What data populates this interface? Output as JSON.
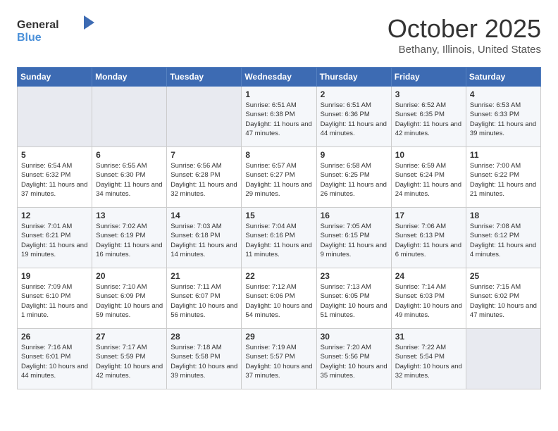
{
  "logo": {
    "general": "General",
    "blue": "Blue"
  },
  "header": {
    "title": "October 2025",
    "subtitle": "Bethany, Illinois, United States"
  },
  "weekdays": [
    "Sunday",
    "Monday",
    "Tuesday",
    "Wednesday",
    "Thursday",
    "Friday",
    "Saturday"
  ],
  "weeks": [
    [
      {
        "day": "",
        "sunrise": "",
        "sunset": "",
        "daylight": ""
      },
      {
        "day": "",
        "sunrise": "",
        "sunset": "",
        "daylight": ""
      },
      {
        "day": "",
        "sunrise": "",
        "sunset": "",
        "daylight": ""
      },
      {
        "day": "1",
        "sunrise": "Sunrise: 6:51 AM",
        "sunset": "Sunset: 6:38 PM",
        "daylight": "Daylight: 11 hours and 47 minutes."
      },
      {
        "day": "2",
        "sunrise": "Sunrise: 6:51 AM",
        "sunset": "Sunset: 6:36 PM",
        "daylight": "Daylight: 11 hours and 44 minutes."
      },
      {
        "day": "3",
        "sunrise": "Sunrise: 6:52 AM",
        "sunset": "Sunset: 6:35 PM",
        "daylight": "Daylight: 11 hours and 42 minutes."
      },
      {
        "day": "4",
        "sunrise": "Sunrise: 6:53 AM",
        "sunset": "Sunset: 6:33 PM",
        "daylight": "Daylight: 11 hours and 39 minutes."
      }
    ],
    [
      {
        "day": "5",
        "sunrise": "Sunrise: 6:54 AM",
        "sunset": "Sunset: 6:32 PM",
        "daylight": "Daylight: 11 hours and 37 minutes."
      },
      {
        "day": "6",
        "sunrise": "Sunrise: 6:55 AM",
        "sunset": "Sunset: 6:30 PM",
        "daylight": "Daylight: 11 hours and 34 minutes."
      },
      {
        "day": "7",
        "sunrise": "Sunrise: 6:56 AM",
        "sunset": "Sunset: 6:28 PM",
        "daylight": "Daylight: 11 hours and 32 minutes."
      },
      {
        "day": "8",
        "sunrise": "Sunrise: 6:57 AM",
        "sunset": "Sunset: 6:27 PM",
        "daylight": "Daylight: 11 hours and 29 minutes."
      },
      {
        "day": "9",
        "sunrise": "Sunrise: 6:58 AM",
        "sunset": "Sunset: 6:25 PM",
        "daylight": "Daylight: 11 hours and 26 minutes."
      },
      {
        "day": "10",
        "sunrise": "Sunrise: 6:59 AM",
        "sunset": "Sunset: 6:24 PM",
        "daylight": "Daylight: 11 hours and 24 minutes."
      },
      {
        "day": "11",
        "sunrise": "Sunrise: 7:00 AM",
        "sunset": "Sunset: 6:22 PM",
        "daylight": "Daylight: 11 hours and 21 minutes."
      }
    ],
    [
      {
        "day": "12",
        "sunrise": "Sunrise: 7:01 AM",
        "sunset": "Sunset: 6:21 PM",
        "daylight": "Daylight: 11 hours and 19 minutes."
      },
      {
        "day": "13",
        "sunrise": "Sunrise: 7:02 AM",
        "sunset": "Sunset: 6:19 PM",
        "daylight": "Daylight: 11 hours and 16 minutes."
      },
      {
        "day": "14",
        "sunrise": "Sunrise: 7:03 AM",
        "sunset": "Sunset: 6:18 PM",
        "daylight": "Daylight: 11 hours and 14 minutes."
      },
      {
        "day": "15",
        "sunrise": "Sunrise: 7:04 AM",
        "sunset": "Sunset: 6:16 PM",
        "daylight": "Daylight: 11 hours and 11 minutes."
      },
      {
        "day": "16",
        "sunrise": "Sunrise: 7:05 AM",
        "sunset": "Sunset: 6:15 PM",
        "daylight": "Daylight: 11 hours and 9 minutes."
      },
      {
        "day": "17",
        "sunrise": "Sunrise: 7:06 AM",
        "sunset": "Sunset: 6:13 PM",
        "daylight": "Daylight: 11 hours and 6 minutes."
      },
      {
        "day": "18",
        "sunrise": "Sunrise: 7:08 AM",
        "sunset": "Sunset: 6:12 PM",
        "daylight": "Daylight: 11 hours and 4 minutes."
      }
    ],
    [
      {
        "day": "19",
        "sunrise": "Sunrise: 7:09 AM",
        "sunset": "Sunset: 6:10 PM",
        "daylight": "Daylight: 11 hours and 1 minute."
      },
      {
        "day": "20",
        "sunrise": "Sunrise: 7:10 AM",
        "sunset": "Sunset: 6:09 PM",
        "daylight": "Daylight: 10 hours and 59 minutes."
      },
      {
        "day": "21",
        "sunrise": "Sunrise: 7:11 AM",
        "sunset": "Sunset: 6:07 PM",
        "daylight": "Daylight: 10 hours and 56 minutes."
      },
      {
        "day": "22",
        "sunrise": "Sunrise: 7:12 AM",
        "sunset": "Sunset: 6:06 PM",
        "daylight": "Daylight: 10 hours and 54 minutes."
      },
      {
        "day": "23",
        "sunrise": "Sunrise: 7:13 AM",
        "sunset": "Sunset: 6:05 PM",
        "daylight": "Daylight: 10 hours and 51 minutes."
      },
      {
        "day": "24",
        "sunrise": "Sunrise: 7:14 AM",
        "sunset": "Sunset: 6:03 PM",
        "daylight": "Daylight: 10 hours and 49 minutes."
      },
      {
        "day": "25",
        "sunrise": "Sunrise: 7:15 AM",
        "sunset": "Sunset: 6:02 PM",
        "daylight": "Daylight: 10 hours and 47 minutes."
      }
    ],
    [
      {
        "day": "26",
        "sunrise": "Sunrise: 7:16 AM",
        "sunset": "Sunset: 6:01 PM",
        "daylight": "Daylight: 10 hours and 44 minutes."
      },
      {
        "day": "27",
        "sunrise": "Sunrise: 7:17 AM",
        "sunset": "Sunset: 5:59 PM",
        "daylight": "Daylight: 10 hours and 42 minutes."
      },
      {
        "day": "28",
        "sunrise": "Sunrise: 7:18 AM",
        "sunset": "Sunset: 5:58 PM",
        "daylight": "Daylight: 10 hours and 39 minutes."
      },
      {
        "day": "29",
        "sunrise": "Sunrise: 7:19 AM",
        "sunset": "Sunset: 5:57 PM",
        "daylight": "Daylight: 10 hours and 37 minutes."
      },
      {
        "day": "30",
        "sunrise": "Sunrise: 7:20 AM",
        "sunset": "Sunset: 5:56 PM",
        "daylight": "Daylight: 10 hours and 35 minutes."
      },
      {
        "day": "31",
        "sunrise": "Sunrise: 7:22 AM",
        "sunset": "Sunset: 5:54 PM",
        "daylight": "Daylight: 10 hours and 32 minutes."
      },
      {
        "day": "",
        "sunrise": "",
        "sunset": "",
        "daylight": ""
      }
    ]
  ]
}
